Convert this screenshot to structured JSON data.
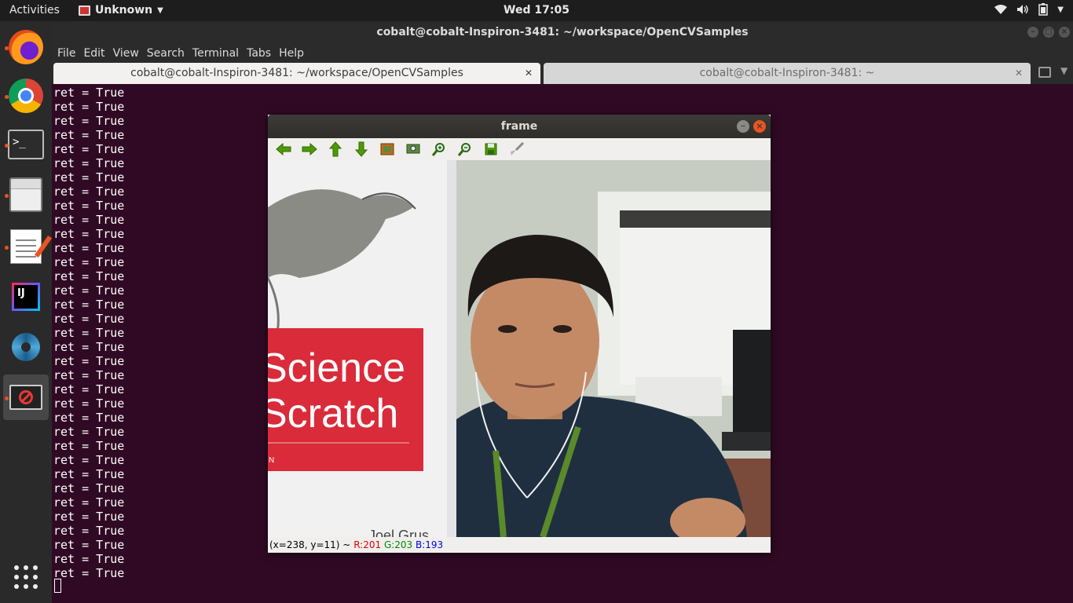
{
  "topbar": {
    "activities": "Activities",
    "app_name": "Unknown",
    "clock": "Wed 17:05"
  },
  "dock": {
    "items": [
      {
        "name": "firefox",
        "icon": "firefox-icon"
      },
      {
        "name": "chrome",
        "icon": "chrome-icon"
      },
      {
        "name": "terminal",
        "icon": "terminal-icon"
      },
      {
        "name": "files",
        "icon": "files-cabinet-icon"
      },
      {
        "name": "text-editor",
        "icon": "text-editor-icon"
      },
      {
        "name": "intellij",
        "icon": "intellij-icon"
      },
      {
        "name": "shutter",
        "icon": "shutter-icon"
      },
      {
        "name": "unknown-app",
        "icon": "blocked-app-icon"
      }
    ]
  },
  "terminal": {
    "title": "cobalt@cobalt-Inspiron-3481: ~/workspace/OpenCVSamples",
    "menu": [
      "File",
      "Edit",
      "View",
      "Search",
      "Terminal",
      "Tabs",
      "Help"
    ],
    "tabs": [
      {
        "label": "cobalt@cobalt-Inspiron-3481: ~/workspace/OpenCVSamples",
        "active": true
      },
      {
        "label": "cobalt@cobalt-Inspiron-3481: ~",
        "active": false
      }
    ],
    "line_text": "ret = True",
    "line_count": 35
  },
  "frame_window": {
    "title": "frame",
    "status": {
      "coords": "(x=238, y=11) ~",
      "r": "R:201",
      "g": "G:203",
      "b": "B:193"
    },
    "image": {
      "book_title_line1": "Science",
      "book_title_line2": "Scratch",
      "book_small": "N",
      "book_author": "Joel Grus"
    }
  },
  "colors": {
    "terminal_bg": "#300a24",
    "accent": "#e95420",
    "book_red": "#d92b3a"
  }
}
